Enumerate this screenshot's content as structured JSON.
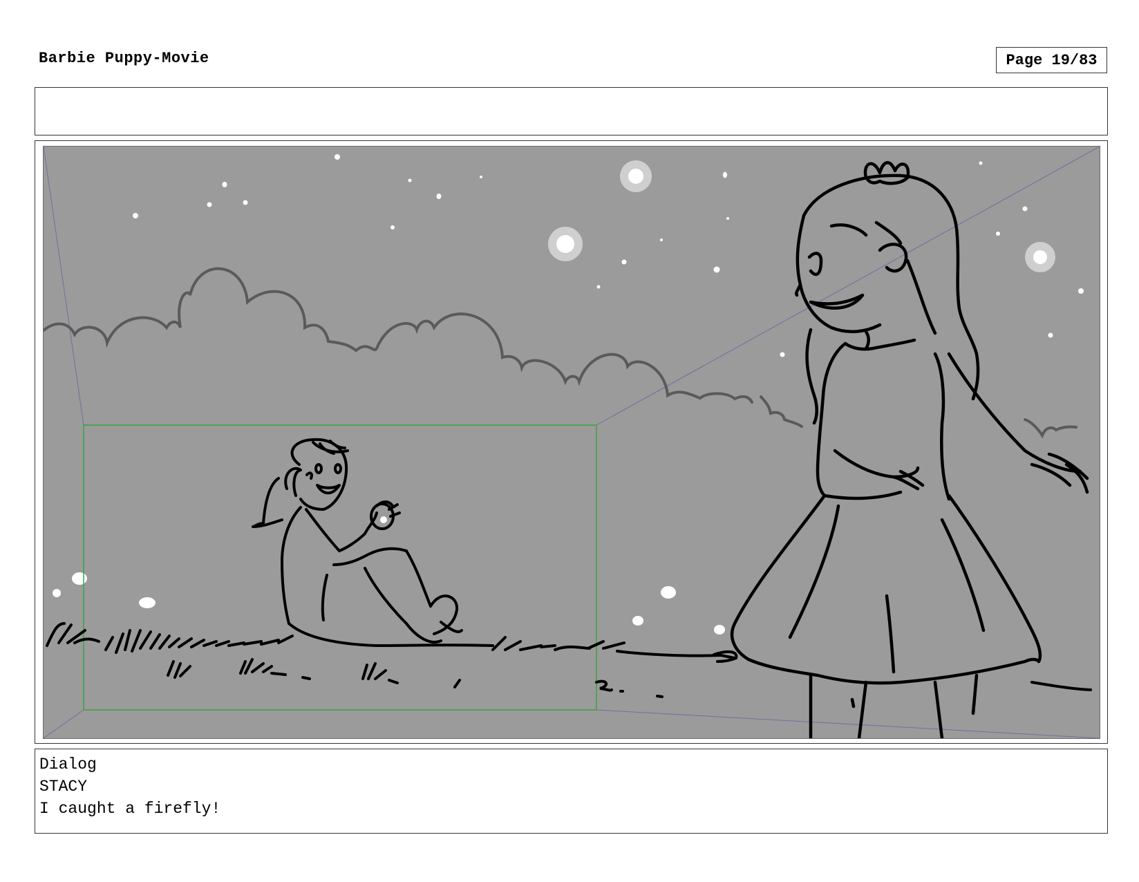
{
  "header": {
    "title": "Barbie Puppy-Movie",
    "page_label": "Page 19/83"
  },
  "notes": {
    "text": ""
  },
  "dialog": {
    "heading": "Dialog",
    "character": "STACY",
    "line": "I caught a firefly!"
  },
  "colors": {
    "panel_background": "#9b9b9b",
    "sketch_line": "#000000",
    "cloud_line": "#5a5a5a",
    "camera_frame": "#3aa33a",
    "perspective_line": "#6f6fa0",
    "firefly_glow": "#ffffff"
  }
}
